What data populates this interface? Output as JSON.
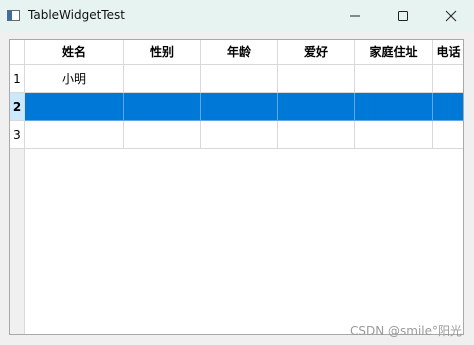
{
  "window": {
    "title": "TableWidgetTest",
    "controls": {
      "minimize_icon": "minimize-icon",
      "maximize_icon": "maximize-icon",
      "close_icon": "close-icon"
    }
  },
  "table": {
    "columns": [
      "姓名",
      "性别",
      "年龄",
      "爱好",
      "家庭住址",
      "电话"
    ],
    "row_numbers": [
      "1",
      "2",
      "3"
    ],
    "rows": [
      [
        "小明",
        "",
        "",
        "",
        "",
        ""
      ],
      [
        "",
        "",
        "",
        "",
        "",
        ""
      ],
      [
        "",
        "",
        "",
        "",
        "",
        ""
      ]
    ],
    "selected_row": 2,
    "selection_color": "#0078d7"
  },
  "watermark": "CSDN @smile°阳光"
}
